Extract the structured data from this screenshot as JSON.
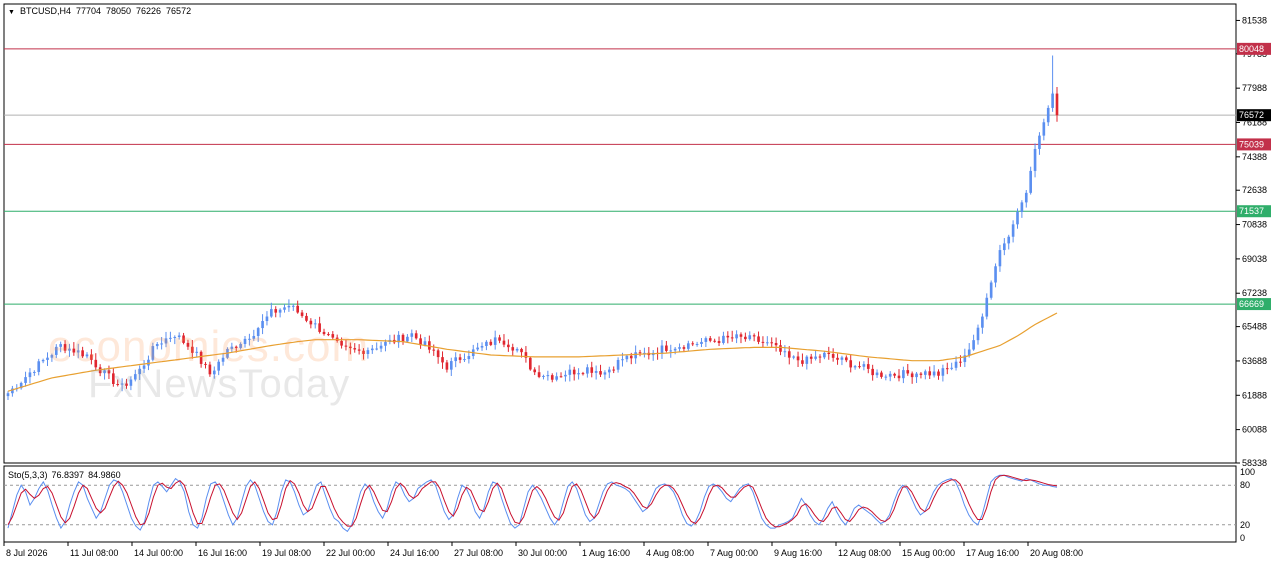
{
  "header": {
    "symbol": "BTCUSD,H4",
    "open": "77704",
    "high": "78050",
    "low": "76226",
    "close": "76572"
  },
  "stochastic": {
    "label": "Sto(5,3,3)",
    "main": "76.8397",
    "signal": "84.9860"
  },
  "watermark": {
    "line1": "economies.com",
    "line2": "FxNewsToday"
  },
  "colors": {
    "up": "#5b8ff0",
    "down": "#e0262f",
    "ma": "#e8a030",
    "resistance": "#c2304a",
    "support": "#2fae6a",
    "current": "#000000",
    "sto_main": "#5b8ff0",
    "sto_signal": "#c8102e"
  },
  "chart_data": [
    {
      "type": "candlestick",
      "ylim": [
        58338,
        82400
      ],
      "yticks": [
        "81538",
        "79788",
        "77988",
        "76188",
        "74388",
        "72638",
        "70838",
        "69038",
        "67238",
        "65488",
        "63688",
        "61888",
        "60088",
        "58338"
      ],
      "xticks": [
        "8 Jul 2026",
        "11 Jul 08:00",
        "14 Jul 00:00",
        "16 Jul 16:00",
        "19 Jul 08:00",
        "22 Jul 00:00",
        "24 Jul 16:00",
        "27 Jul 08:00",
        "30 Jul 00:00",
        "1 Aug 16:00",
        "4 Aug 08:00",
        "7 Aug 00:00",
        "9 Aug 16:00",
        "12 Aug 08:00",
        "15 Aug 00:00",
        "17 Aug 16:00",
        "20 Aug 08:00"
      ],
      "path": [
        [
          0,
          62000
        ],
        [
          6,
          63300
        ],
        [
          12,
          64500
        ],
        [
          18,
          64000
        ],
        [
          22,
          63000
        ],
        [
          26,
          62300
        ],
        [
          30,
          63200
        ],
        [
          34,
          64600
        ],
        [
          38,
          65100
        ],
        [
          42,
          64300
        ],
        [
          46,
          63000
        ],
        [
          50,
          64200
        ],
        [
          56,
          65200
        ],
        [
          60,
          66200
        ],
        [
          64,
          66600
        ],
        [
          68,
          65900
        ],
        [
          72,
          65200
        ],
        [
          76,
          64300
        ],
        [
          80,
          64200
        ],
        [
          86,
          64600
        ],
        [
          92,
          65100
        ],
        [
          96,
          64300
        ],
        [
          100,
          63400
        ],
        [
          104,
          64000
        ],
        [
          108,
          64400
        ],
        [
          112,
          64900
        ],
        [
          116,
          64300
        ],
        [
          120,
          63100
        ],
        [
          124,
          62900
        ],
        [
          128,
          63100
        ],
        [
          132,
          63300
        ],
        [
          136,
          63100
        ],
        [
          140,
          63800
        ],
        [
          146,
          64100
        ],
        [
          150,
          64400
        ],
        [
          156,
          64600
        ],
        [
          162,
          64800
        ],
        [
          166,
          64900
        ],
        [
          170,
          64800
        ],
        [
          174,
          64500
        ],
        [
          178,
          63800
        ],
        [
          182,
          63700
        ],
        [
          186,
          64000
        ],
        [
          190,
          63700
        ],
        [
          194,
          63400
        ],
        [
          198,
          63000
        ],
        [
          204,
          63000
        ],
        [
          208,
          63100
        ],
        [
          212,
          63000
        ],
        [
          216,
          63500
        ],
        [
          220,
          64600
        ],
        [
          224,
          67800
        ],
        [
          226,
          69500
        ],
        [
          228,
          70200
        ],
        [
          230,
          71500
        ],
        [
          232,
          72500
        ],
        [
          234,
          74800
        ],
        [
          236,
          76200
        ],
        [
          238,
          77704
        ],
        [
          239,
          76572
        ]
      ],
      "sma_path": [
        [
          0,
          62100
        ],
        [
          10,
          62800
        ],
        [
          20,
          63200
        ],
        [
          30,
          63500
        ],
        [
          40,
          63800
        ],
        [
          50,
          64100
        ],
        [
          60,
          64500
        ],
        [
          66,
          64700
        ],
        [
          70,
          64800
        ],
        [
          80,
          64800
        ],
        [
          90,
          64700
        ],
        [
          100,
          64300
        ],
        [
          110,
          64000
        ],
        [
          120,
          63900
        ],
        [
          130,
          63900
        ],
        [
          140,
          64000
        ],
        [
          150,
          64100
        ],
        [
          160,
          64300
        ],
        [
          170,
          64400
        ],
        [
          176,
          64400
        ],
        [
          186,
          64200
        ],
        [
          196,
          63900
        ],
        [
          206,
          63700
        ],
        [
          212,
          63700
        ],
        [
          218,
          63900
        ],
        [
          222,
          64200
        ],
        [
          226,
          64500
        ],
        [
          230,
          65000
        ],
        [
          234,
          65600
        ],
        [
          239,
          66200
        ]
      ],
      "levels": [
        {
          "value": 80048,
          "label": "80048",
          "role": "resistance"
        },
        {
          "value": 76572,
          "label": "76572",
          "role": "current"
        },
        {
          "value": 75039,
          "label": "75039",
          "role": "resistance"
        },
        {
          "value": 71537,
          "label": "71537",
          "role": "support"
        },
        {
          "value": 66669,
          "label": "66669",
          "role": "support"
        }
      ],
      "bars": 240
    },
    {
      "type": "line",
      "ylim": [
        0,
        100
      ],
      "yticks": [
        "100",
        "80",
        "20",
        "0"
      ],
      "levels": [
        80,
        20
      ],
      "series": [
        {
          "key": "main",
          "values": [
            15,
            40,
            65,
            80,
            70,
            50,
            60,
            75,
            85,
            72,
            50,
            30,
            15,
            25,
            50,
            70,
            85,
            80,
            60,
            45,
            30,
            40,
            60,
            80,
            88,
            85,
            70,
            50,
            30,
            18,
            12,
            25,
            55,
            80,
            85,
            78,
            70,
            80,
            90,
            85,
            70,
            40,
            20,
            15,
            30,
            60,
            82,
            85,
            75,
            55,
            35,
            20,
            30,
            55,
            78,
            88,
            80,
            60,
            40,
            25,
            20,
            40,
            70,
            88,
            85,
            70,
            50,
            35,
            40,
            60,
            80,
            85,
            65,
            45,
            30,
            25,
            15,
            10,
            20,
            45,
            70,
            82,
            75,
            55,
            40,
            30,
            45,
            70,
            85,
            80,
            65,
            55,
            60,
            75,
            80,
            85,
            88,
            80,
            60,
            40,
            28,
            35,
            60,
            80,
            75,
            60,
            40,
            30,
            45,
            70,
            85,
            82,
            60,
            40,
            22,
            15,
            20,
            45,
            70,
            80,
            72,
            60,
            45,
            30,
            20,
            30,
            55,
            78,
            85,
            75,
            55,
            35,
            25,
            30,
            50,
            70,
            82,
            85,
            80,
            78,
            75,
            70,
            60,
            50,
            40,
            45,
            60,
            75,
            80,
            82,
            78,
            70,
            55,
            35,
            22,
            18,
            25,
            40,
            62,
            78,
            82,
            78,
            70,
            60,
            55,
            65,
            75,
            80,
            82,
            70,
            50,
            30,
            20,
            15,
            15,
            20,
            22,
            25,
            30,
            45,
            60,
            50,
            35,
            25,
            20,
            30,
            45,
            55,
            40,
            28,
            20,
            30,
            45,
            50,
            45,
            40,
            35,
            28,
            22,
            25,
            35,
            55,
            72,
            80,
            75,
            60,
            45,
            35,
            40,
            55,
            70,
            80,
            85,
            88,
            90,
            85,
            70,
            50,
            35,
            25,
            20,
            35,
            60,
            85,
            92,
            95,
            95,
            92,
            90,
            88,
            86,
            90,
            88,
            85,
            82,
            80,
            80,
            78,
            77
          ]
        },
        {
          "key": "signal",
          "values": [
            20,
            32,
            50,
            68,
            74,
            66,
            60,
            65,
            75,
            78,
            68,
            50,
            32,
            23,
            30,
            48,
            68,
            80,
            75,
            60,
            45,
            38,
            45,
            62,
            78,
            86,
            80,
            68,
            50,
            32,
            20,
            22,
            38,
            62,
            80,
            83,
            77,
            75,
            83,
            87,
            80,
            60,
            38,
            22,
            22,
            40,
            62,
            80,
            82,
            72,
            55,
            38,
            28,
            38,
            58,
            78,
            85,
            75,
            57,
            38,
            28,
            30,
            50,
            75,
            87,
            82,
            68,
            50,
            40,
            45,
            62,
            78,
            78,
            62,
            45,
            32,
            24,
            18,
            18,
            30,
            52,
            72,
            80,
            70,
            55,
            42,
            40,
            55,
            75,
            83,
            77,
            65,
            60,
            65,
            75,
            80,
            85,
            85,
            75,
            57,
            40,
            33,
            45,
            65,
            77,
            72,
            57,
            43,
            40,
            55,
            75,
            83,
            75,
            55,
            37,
            24,
            22,
            32,
            52,
            72,
            78,
            72,
            60,
            45,
            32,
            27,
            38,
            60,
            78,
            82,
            72,
            55,
            38,
            30,
            38,
            55,
            72,
            82,
            84,
            82,
            78,
            75,
            68,
            58,
            48,
            45,
            52,
            65,
            75,
            80,
            80,
            75,
            65,
            50,
            35,
            25,
            22,
            30,
            45,
            65,
            78,
            80,
            76,
            68,
            62,
            62,
            70,
            77,
            80,
            77,
            62,
            45,
            30,
            22,
            17,
            17,
            20,
            23,
            28,
            35,
            48,
            52,
            45,
            35,
            27,
            25,
            33,
            45,
            47,
            38,
            28,
            25,
            33,
            43,
            47,
            45,
            40,
            33,
            27,
            25,
            30,
            43,
            62,
            77,
            78,
            70,
            57,
            45,
            40,
            45,
            60,
            73,
            82,
            85,
            88,
            88,
            82,
            68,
            52,
            38,
            28,
            28,
            45,
            70,
            88,
            94,
            95,
            94,
            92,
            90,
            88,
            87,
            88,
            87,
            85,
            83,
            81,
            80,
            79
          ]
        }
      ]
    }
  ]
}
